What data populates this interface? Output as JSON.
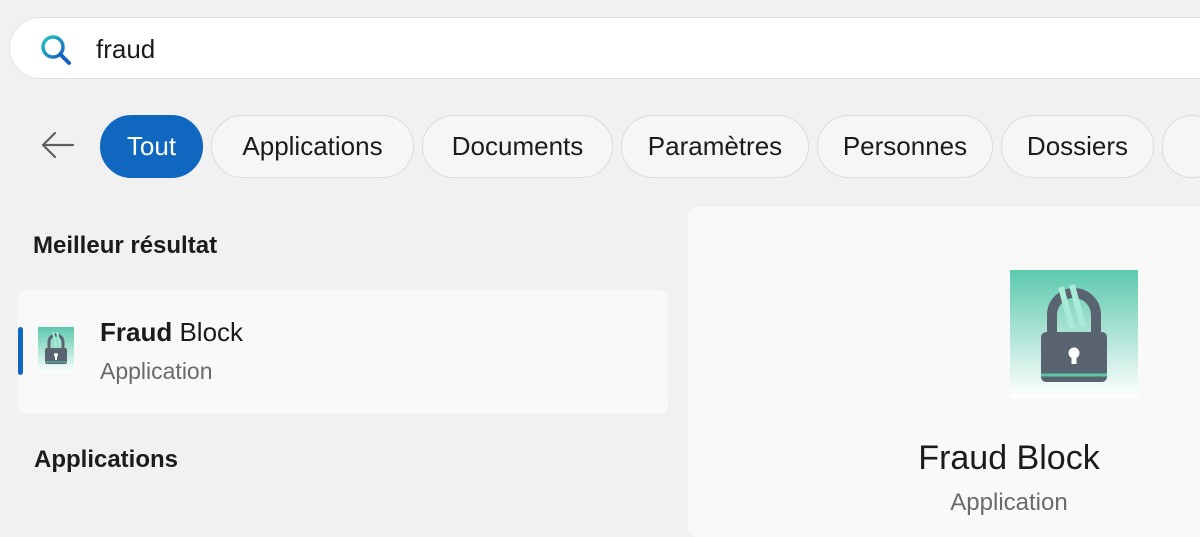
{
  "search": {
    "query": "fraud",
    "icon": "search-icon"
  },
  "filters": {
    "back_icon": "back-arrow-icon",
    "chips": [
      "Tout",
      "Applications",
      "Documents",
      "Paramètres",
      "Personnes",
      "Dossiers"
    ],
    "active": "Tout"
  },
  "best_result": {
    "section_title": "Meilleur résultat",
    "name_match": "Fraud",
    "name_rest": " Block",
    "type": "Application",
    "icon": "fraud-block-app-icon"
  },
  "applications": {
    "section_title": "Applications"
  },
  "preview": {
    "name": "Fraud Block",
    "type": "Application",
    "icon": "fraud-block-app-icon"
  },
  "colors": {
    "accent": "#0f67c0",
    "icon_teal": "#5cc9ad",
    "lock_body": "#5a6470"
  }
}
